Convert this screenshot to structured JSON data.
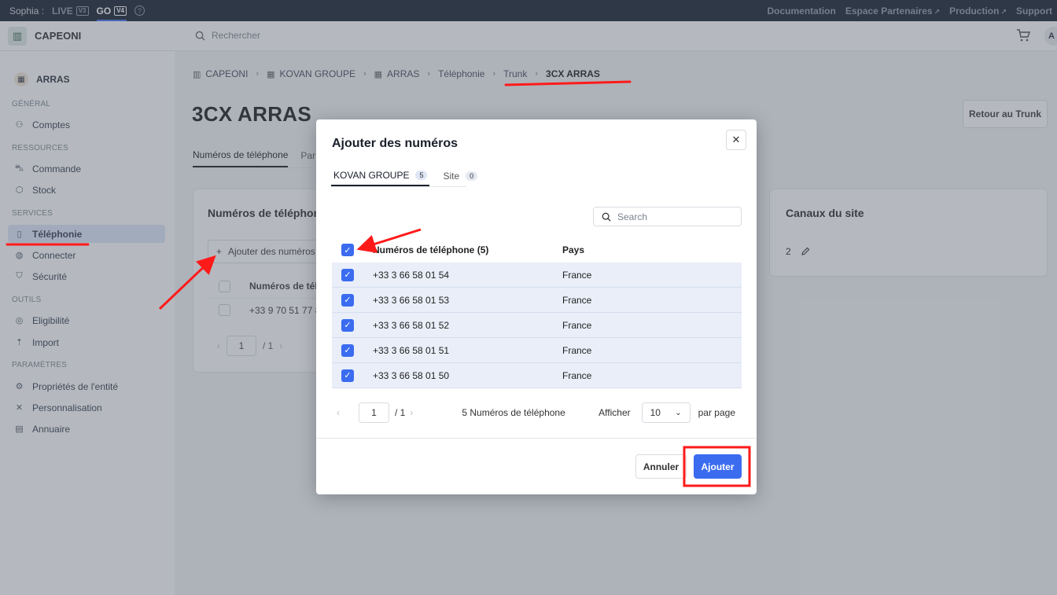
{
  "topbar": {
    "user": "Sophia :",
    "envs": [
      {
        "label": "LIVE",
        "version": "V3",
        "active": false
      },
      {
        "label": "GO",
        "version": "V4",
        "active": true
      }
    ],
    "links": [
      "Documentation",
      "Espace Partenaires",
      "Production",
      "Support"
    ]
  },
  "header": {
    "brand": "CAPEONI",
    "search_placeholder": "Rechercher",
    "avatar": "A"
  },
  "sidebar": {
    "entity": "ARRAS",
    "sections": [
      {
        "title": "GÉNÉRAL",
        "items": [
          {
            "label": "Comptes",
            "icon": "users-icon"
          }
        ]
      },
      {
        "title": "RESSOURCES",
        "items": [
          {
            "label": "Commande",
            "icon": "cart-icon"
          },
          {
            "label": "Stock",
            "icon": "box-icon"
          }
        ]
      },
      {
        "title": "SERVICES",
        "items": [
          {
            "label": "Téléphonie",
            "icon": "phone-icon",
            "active": true
          },
          {
            "label": "Connecter",
            "icon": "globe-icon"
          },
          {
            "label": "Sécurité",
            "icon": "shield-icon"
          }
        ]
      },
      {
        "title": "OUTILS",
        "items": [
          {
            "label": "Eligibilité",
            "icon": "eligibility-icon"
          },
          {
            "label": "Import",
            "icon": "upload-icon"
          }
        ]
      },
      {
        "title": "PARAMÈTRES",
        "items": [
          {
            "label": "Propriétés de l'entité",
            "icon": "settings-icon"
          },
          {
            "label": "Personnalisation",
            "icon": "tools-icon"
          },
          {
            "label": "Annuaire",
            "icon": "directory-icon"
          }
        ]
      }
    ]
  },
  "breadcrumb": [
    "CAPEONI",
    "KOVAN GROUPE",
    "ARRAS",
    "Téléphonie",
    "Trunk",
    "3CX ARRAS"
  ],
  "page": {
    "title": "3CX ARRAS",
    "back_button": "Retour au Trunk",
    "tabs": [
      "Numéros de téléphone",
      "Par"
    ]
  },
  "left_card": {
    "title": "Numéros de téléphone",
    "add_button": "Ajouter des numéros",
    "col_header": "Numéros de télé",
    "row_value": "+33 9 70 51 77 8",
    "page": "1",
    "page_of": "/ 1"
  },
  "right_card": {
    "title": "Canaux du site",
    "value": "2"
  },
  "modal": {
    "title": "Ajouter des numéros",
    "tabs": [
      {
        "label": "KOVAN GROUPE",
        "count": "5",
        "active": true
      },
      {
        "label": "Site",
        "count": "0",
        "active": false
      }
    ],
    "search_placeholder": "Search",
    "columns": {
      "numbers": "Numéros de téléphone (5)",
      "country": "Pays"
    },
    "rows": [
      {
        "number": "+33 3 66 58 01 54",
        "country": "France"
      },
      {
        "number": "+33 3 66 58 01 53",
        "country": "France"
      },
      {
        "number": "+33 3 66 58 01 52",
        "country": "France"
      },
      {
        "number": "+33 3 66 58 01 51",
        "country": "France"
      },
      {
        "number": "+33 3 66 58 01 50",
        "country": "France"
      }
    ],
    "pager": {
      "page": "1",
      "of": "/ 1",
      "count_text": "5 Numéros de téléphone",
      "show_label": "Afficher",
      "per_page_value": "10",
      "per_page_label": "par page"
    },
    "cancel_button": "Annuler",
    "add_button": "Ajouter"
  },
  "colors": {
    "accent": "#3b6cf0",
    "annotation": "#ff1a1a"
  }
}
